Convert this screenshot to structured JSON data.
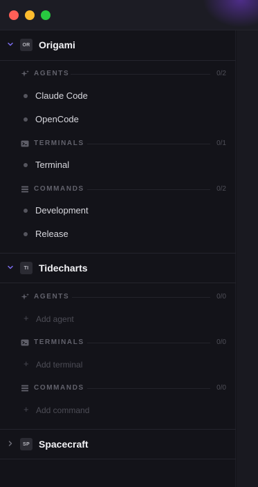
{
  "window": {
    "controls": [
      "close",
      "minimize",
      "maximize"
    ],
    "colors": {
      "close": "#fe5f57",
      "minimize": "#febc2e",
      "maximize": "#28c840"
    }
  },
  "projects": [
    {
      "badge": "OR",
      "name": "Origami",
      "expanded": true,
      "sections": [
        {
          "icon": "sparkles-icon",
          "title": "AGENTS",
          "count": "0/2",
          "items": [
            "Claude Code",
            "OpenCode"
          ]
        },
        {
          "icon": "terminal-icon",
          "title": "TERMINALS",
          "count": "0/1",
          "items": [
            "Terminal"
          ]
        },
        {
          "icon": "commands-icon",
          "title": "COMMANDS",
          "count": "0/2",
          "items": [
            "Development",
            "Release"
          ]
        }
      ]
    },
    {
      "badge": "TI",
      "name": "Tidecharts",
      "expanded": true,
      "sections": [
        {
          "icon": "sparkles-icon",
          "title": "AGENTS",
          "count": "0/0",
          "add": "Add agent"
        },
        {
          "icon": "terminal-icon",
          "title": "TERMINALS",
          "count": "0/0",
          "add": "Add terminal"
        },
        {
          "icon": "commands-icon",
          "title": "COMMANDS",
          "count": "0/0",
          "add": "Add command"
        }
      ]
    },
    {
      "badge": "SP",
      "name": "Spacecraft",
      "expanded": false
    }
  ]
}
